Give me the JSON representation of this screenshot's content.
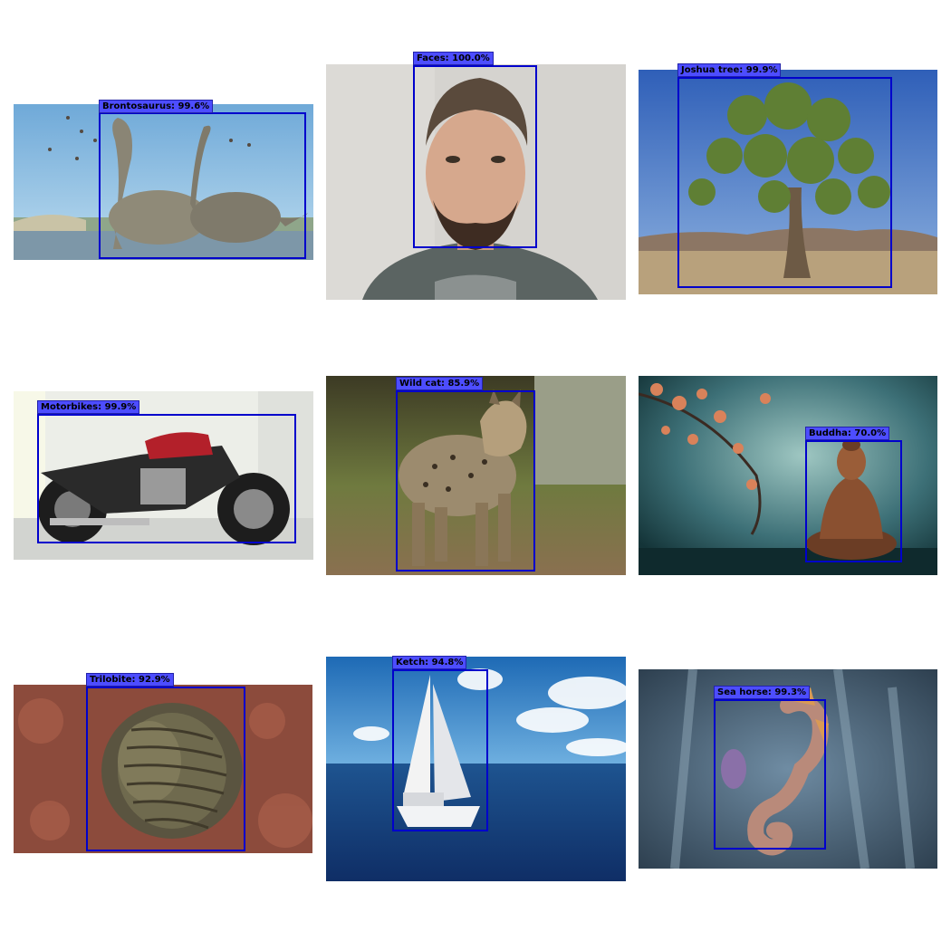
{
  "detections": [
    {
      "label": "Brontosaurus:  99.6%"
    },
    {
      "label": "Faces:  100.0%"
    },
    {
      "label": "Joshua tree:  99.9%"
    },
    {
      "label": "Motorbikes:  99.9%"
    },
    {
      "label": "Wild cat:  85.9%"
    },
    {
      "label": "Buddha:  70.0%"
    },
    {
      "label": "Trilobite:  92.9%"
    },
    {
      "label": "Ketch:  94.8%"
    },
    {
      "label": "Sea horse:  99.3%"
    }
  ],
  "colors": {
    "box": "#0000cc",
    "tag": "#4d4dff"
  }
}
